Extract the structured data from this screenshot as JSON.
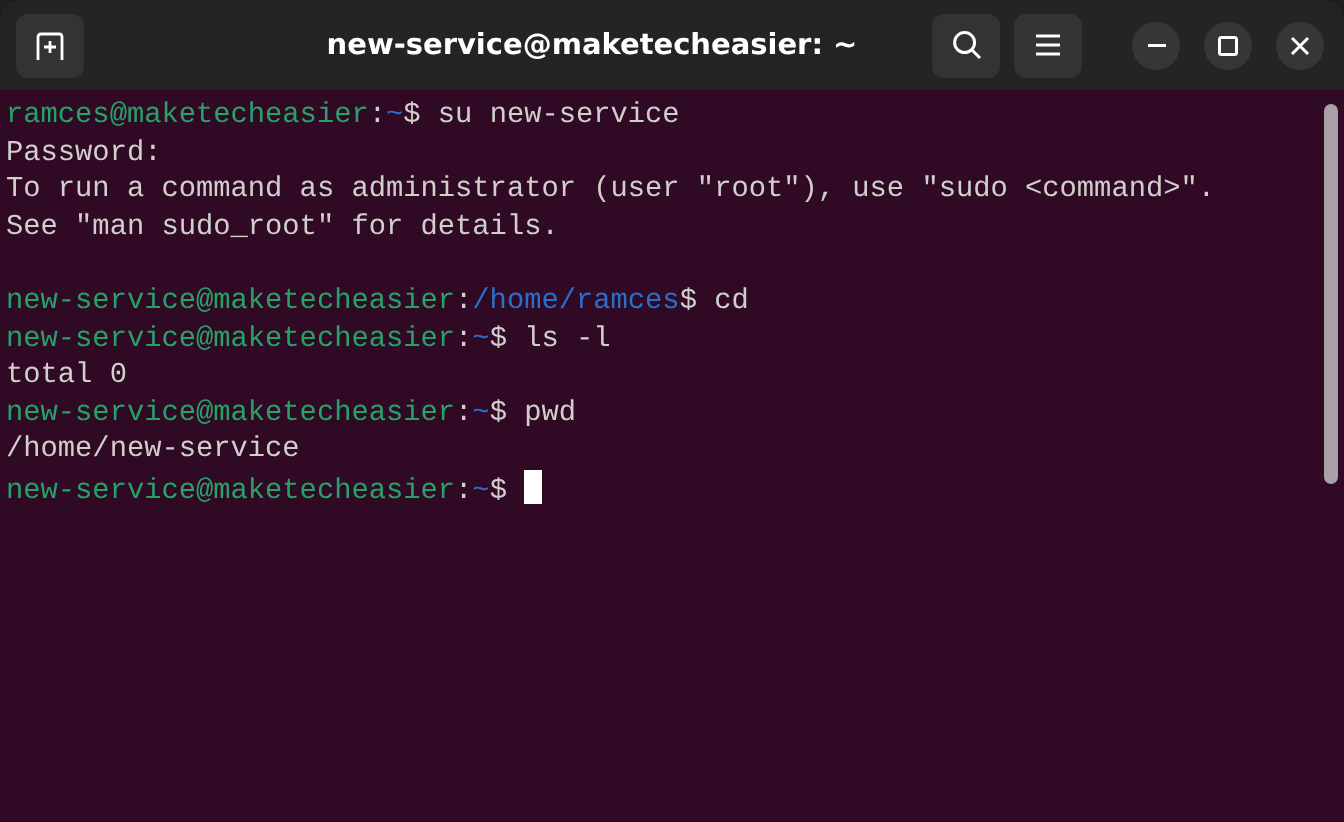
{
  "window": {
    "title": "new-service@maketecheasier: ~"
  },
  "terminal": {
    "lines": [
      {
        "segments": [
          {
            "kind": "user",
            "text": "ramces@maketecheasier"
          },
          {
            "kind": "plain",
            "text": ":"
          },
          {
            "kind": "path",
            "text": "~"
          },
          {
            "kind": "plain",
            "text": "$ su new-service"
          }
        ]
      },
      {
        "segments": [
          {
            "kind": "plain",
            "text": "Password:"
          }
        ]
      },
      {
        "segments": [
          {
            "kind": "plain",
            "text": "To run a command as administrator (user \"root\"), use \"sudo <command>\"."
          }
        ]
      },
      {
        "segments": [
          {
            "kind": "plain",
            "text": "See \"man sudo_root\" for details."
          }
        ]
      },
      {
        "segments": [
          {
            "kind": "user",
            "text": "new-service@maketecheasier"
          },
          {
            "kind": "plain",
            "text": ":"
          },
          {
            "kind": "path",
            "text": "/home/ramces"
          },
          {
            "kind": "plain",
            "text": "$ cd"
          }
        ],
        "blank_line_before": true
      },
      {
        "segments": [
          {
            "kind": "user",
            "text": "new-service@maketecheasier"
          },
          {
            "kind": "plain",
            "text": ":"
          },
          {
            "kind": "path",
            "text": "~"
          },
          {
            "kind": "plain",
            "text": "$ ls -l"
          }
        ]
      },
      {
        "segments": [
          {
            "kind": "plain",
            "text": "total 0"
          }
        ]
      },
      {
        "segments": [
          {
            "kind": "user",
            "text": "new-service@maketecheasier"
          },
          {
            "kind": "plain",
            "text": ":"
          },
          {
            "kind": "path",
            "text": "~"
          },
          {
            "kind": "plain",
            "text": "$ pwd"
          }
        ]
      },
      {
        "segments": [
          {
            "kind": "plain",
            "text": "/home/new-service"
          }
        ]
      },
      {
        "segments": [
          {
            "kind": "user",
            "text": "new-service@maketecheasier"
          },
          {
            "kind": "plain",
            "text": ":"
          },
          {
            "kind": "path",
            "text": "~"
          },
          {
            "kind": "plain",
            "text": "$ "
          }
        ],
        "cursor": true
      }
    ]
  }
}
